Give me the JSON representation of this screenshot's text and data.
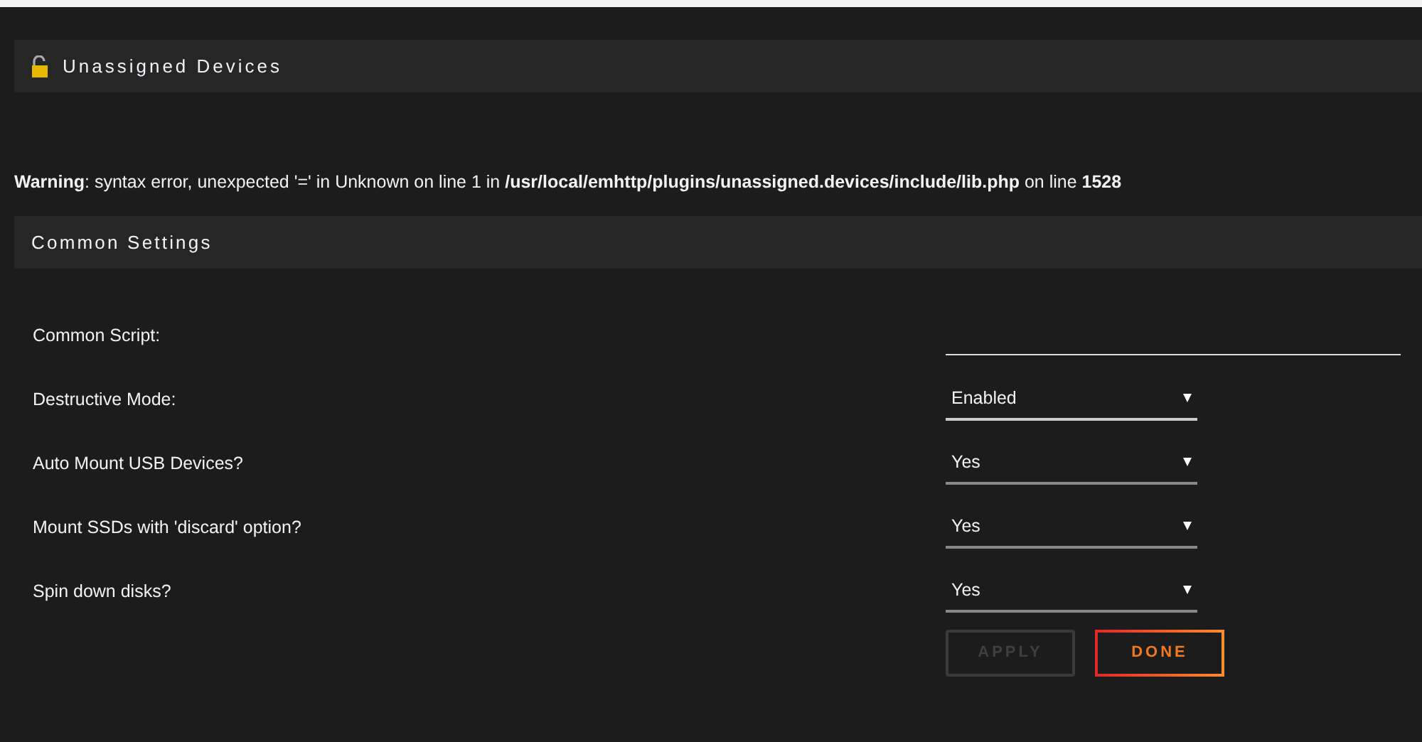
{
  "header": {
    "title": "Unassigned Devices"
  },
  "warning": "**Warning**: syntax error, unexpected '=' in Unknown on line 1 in **/usr/local/emhttp/plugins/unassigned.devices/include/lib.php** on line **1528**",
  "section": {
    "title": "Common Settings"
  },
  "settings": [
    {
      "label": "Common Script:",
      "kind": "text"
    },
    {
      "label": "Destructive Mode:",
      "kind": "select",
      "value": "Enabled"
    },
    {
      "label": "Auto Mount USB Devices?",
      "kind": "select",
      "value": "Yes"
    },
    {
      "label": "Mount SSDs with 'discard' option?",
      "kind": "select",
      "value": "Yes"
    },
    {
      "label": "Spin down disks?",
      "kind": "select",
      "value": "Yes"
    }
  ],
  "buttons": [
    {
      "label": "APPLY",
      "disabled": true
    },
    {
      "label": "DONE",
      "disabled": false
    }
  ]
}
